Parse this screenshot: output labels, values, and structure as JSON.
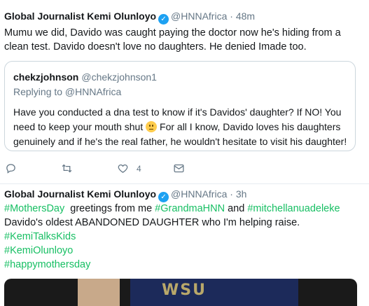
{
  "tweet1": {
    "author_name": "Global Journalist Kemi Olunloyo",
    "handle": "@HNNAfrica",
    "time": "· 48m",
    "text": "Mumu we did, Davido was caught paying the doctor now he's hiding from a clean test. Davido doesn't love no daughters. He denied Imade too.",
    "quoted": {
      "author_name": "chekzjohnson",
      "handle": "@chekzjohnson1",
      "replying_to": "Replying to @HNNAfrica",
      "text_before_emoji": "Have you conducted a dna test to know if it's Davidos' daughter? If NO! You need to keep your mouth shut",
      "text_after_emoji": " For all I know, Davido loves his daughters genuinely and if he's the real father, he wouldn't hesitate to visit his daughter!"
    },
    "actions": {
      "reply_icon": "reply-icon",
      "retweet_icon": "retweet-icon",
      "like_icon": "heart-icon",
      "like_count": "4",
      "dm_icon": "envelope-icon"
    }
  },
  "tweet2": {
    "author_name": "Global Journalist Kemi Olunloyo",
    "handle": "@HNNAfrica",
    "time": "· 3h",
    "line1_tag1": "#MothersDay",
    "line1_mid1": "  greetings from me ",
    "line1_tag2": "#GrandmaHNN",
    "line1_mid2": " and ",
    "line1_tag3": "#mitchellanuadeleke",
    "line2": "Davido's oldest ABANDONED DAUGHTER who I'm helping raise.",
    "tags": [
      "#KemiTalksKids",
      "#KemiOlunloyo",
      "#happymothersday"
    ]
  },
  "colors": {
    "accent": "#1da1f2",
    "hashtag": "#17bf63",
    "muted": "#657786"
  }
}
